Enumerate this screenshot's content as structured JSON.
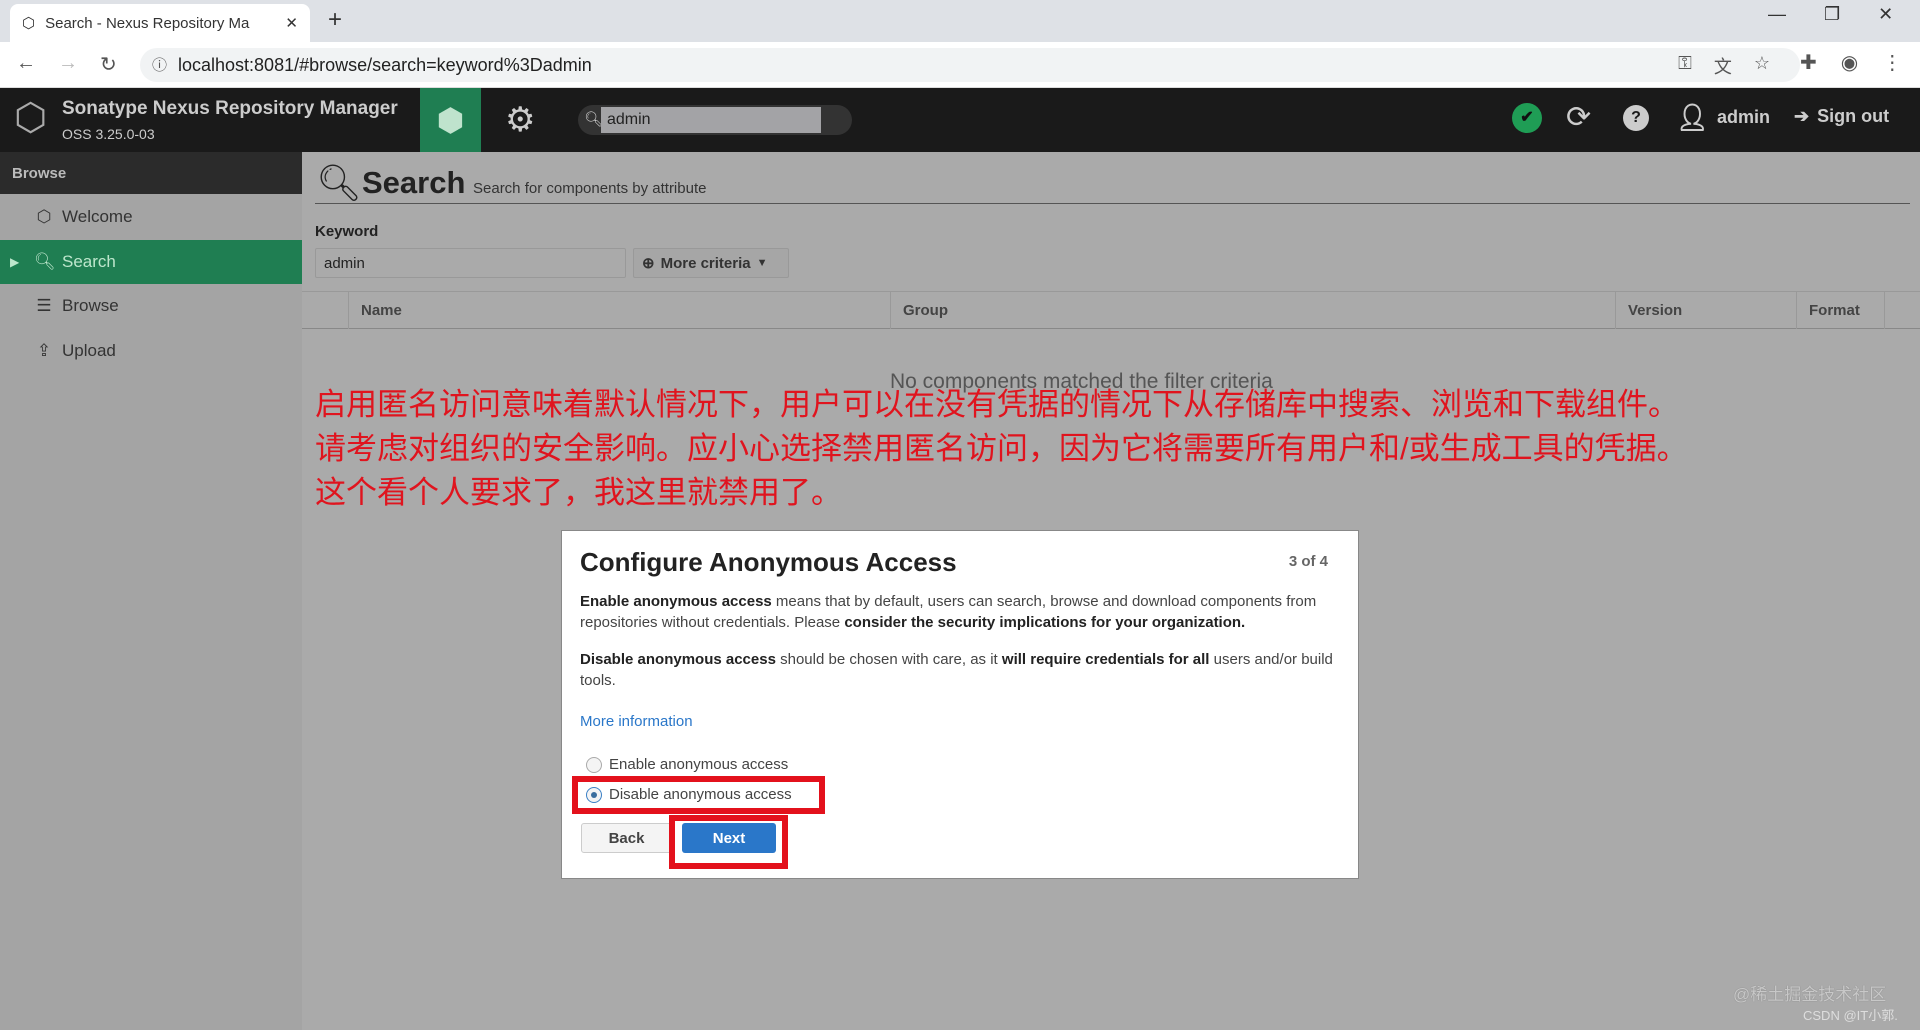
{
  "browser": {
    "tab_title": "Search - Nexus Repository Ma",
    "url": "localhost:8081/#browse/search=keyword%3Dadmin"
  },
  "header": {
    "app_name": "Sonatype Nexus Repository Manager",
    "version": "OSS 3.25.0-03",
    "search_value": "admin",
    "user": "admin",
    "sign_out": "Sign out"
  },
  "sidebar": {
    "heading": "Browse",
    "items": [
      {
        "label": "Welcome"
      },
      {
        "label": "Search"
      },
      {
        "label": "Browse"
      },
      {
        "label": "Upload"
      }
    ]
  },
  "main": {
    "title": "Search",
    "subtitle": "Search for components by attribute",
    "keyword_label": "Keyword",
    "keyword_value": "admin",
    "more_criteria": "More criteria",
    "columns": [
      "Name",
      "Group",
      "Version",
      "Format"
    ],
    "empty_text": "No components matched the filter criteria"
  },
  "annotation": {
    "lines": [
      "启用匿名访问意味着默认情况下，用户可以在没有凭据的情况下从存储库中搜索、浏览和下载组件。",
      "请考虑对组织的安全影响。应小心选择禁用匿名访问，因为它将需要所有用户和/或生成工具的凭据。",
      "这个看个人要求了，我这里就禁用了。"
    ]
  },
  "modal": {
    "title": "Configure Anonymous Access",
    "step": "3 of 4",
    "p1_b1": "Enable anonymous access",
    "p1_t1": " means that by default, users can search, browse and download components from repositories without credentials. Please ",
    "p1_b2": "consider the security implications for your organization.",
    "p2_b1": "Disable anonymous access",
    "p2_t1": " should be chosen with care, as it ",
    "p2_b2": "will require credentials for all",
    "p2_t2": " users and/or build tools.",
    "more_info": "More information",
    "options": [
      {
        "label": "Enable anonymous access",
        "selected": false
      },
      {
        "label": "Disable anonymous access",
        "selected": true
      }
    ],
    "back": "Back",
    "next": "Next"
  },
  "watermark": {
    "line1": "@稀土掘金技术社区",
    "line2": "CSDN @IT小郭."
  },
  "colors": {
    "accent_green": "#1f7e52",
    "primary_blue": "#2a77c9",
    "annotation_red": "#e3111c"
  }
}
